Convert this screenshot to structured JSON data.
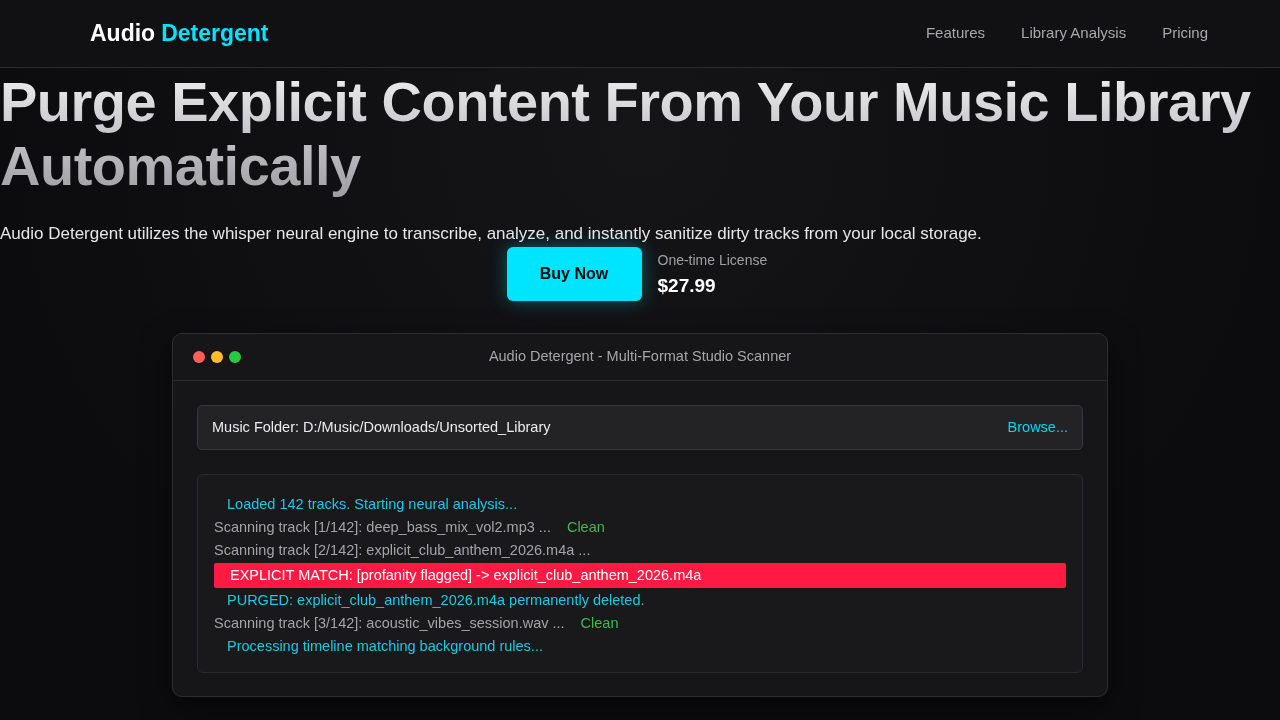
{
  "nav": {
    "logo": {
      "first": "Audio",
      "second": "Detergent"
    },
    "links": [
      {
        "label": "Features"
      },
      {
        "label": "Library Analysis"
      },
      {
        "label": "Pricing"
      }
    ]
  },
  "hero": {
    "title": "Purge Explicit Content From Your Music Library Automatically",
    "subtitle": "Audio Detergent utilizes the whisper neural engine to transcribe, analyze, and instantly sanitize dirty tracks from your local storage.",
    "cta": {
      "label": "Buy Now"
    },
    "price": {
      "caption": "One-time License",
      "amount": "$27.99"
    }
  },
  "app_window": {
    "title": "Audio Detergent - Multi-Format Studio Scanner",
    "folder": {
      "text": "Music Folder: D:/Music/Downloads/Unsorted_Library",
      "browse": "Browse..."
    },
    "log": [
      {
        "kind": "info",
        "text": "Loaded 142 tracks. Starting neural analysis..."
      },
      {
        "kind": "scan",
        "text": "Scanning track [1/142]: deep_bass_mix_vol2.mp3 ...",
        "result": "Clean"
      },
      {
        "kind": "scan",
        "text": "Scanning track [2/142]: explicit_club_anthem_2026.m4a ..."
      },
      {
        "kind": "alert",
        "text": "EXPLICIT MATCH: [profanity flagged] -> explicit_club_anthem_2026.m4a"
      },
      {
        "kind": "info",
        "text": "PURGED: explicit_club_anthem_2026.m4a permanently deleted."
      },
      {
        "kind": "scan",
        "text": "Scanning track [3/142]: acoustic_vibes_session.wav ...",
        "result": "Clean"
      },
      {
        "kind": "info",
        "text": "Processing timeline matching background rules..."
      }
    ]
  }
}
